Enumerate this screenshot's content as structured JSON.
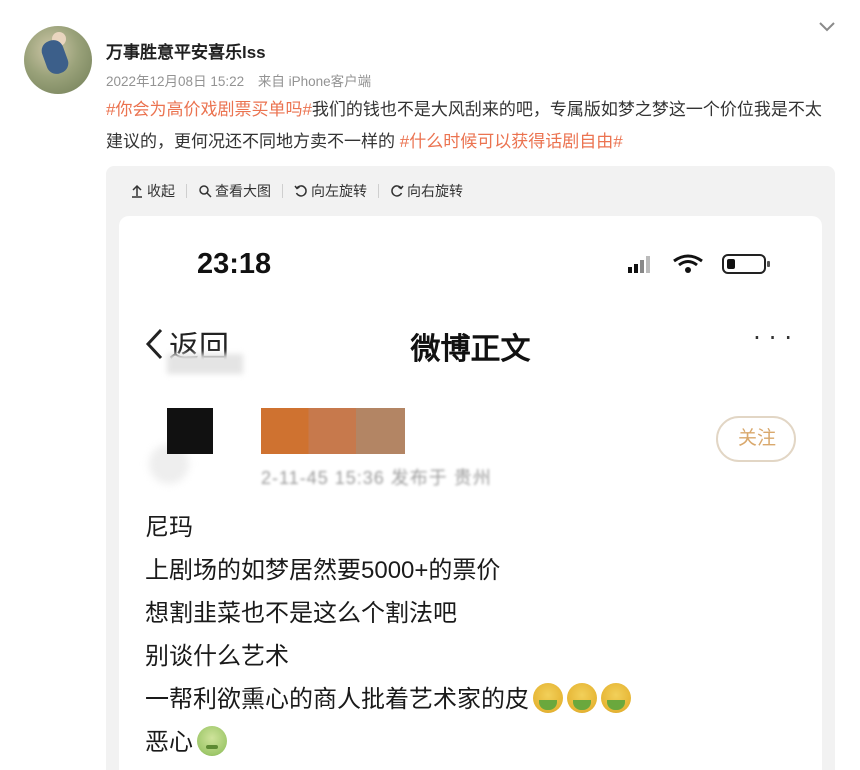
{
  "user": {
    "name": "万事胜意平安喜乐lss",
    "date": "2022年12月08日 15:22",
    "source": "来自 iPhone客户端"
  },
  "post": {
    "tag1": "#你会为高价戏剧票买单吗#",
    "text1": "我们的钱也不是大风刮来的吧，专属版如梦之梦这一个价位我是不太建议的，更何况还不同地方卖不一样的 ",
    "tag2": "#什么时候可以获得话剧自由#"
  },
  "toolbar": {
    "collapse": "收起",
    "view_large": "查看大图",
    "rotate_left": "向左旋转",
    "rotate_right": "向右旋转"
  },
  "screenshot": {
    "time": "23:18",
    "back": "返回",
    "title": "微博正文",
    "more": "···",
    "follow": "关注",
    "subline": "2-11-45 15:36  发布于 贵州",
    "lines": [
      "尼玛",
      "上剧场的如梦居然要5000+的票价",
      "想割韭菜也不是这么个割法吧",
      "别谈什么艺术",
      "一帮利欲熏心的商人批着艺术家的皮",
      "恶心"
    ]
  },
  "colors": {
    "accent": "#eb7350",
    "muted": "#939393",
    "panel_bg": "#f2f2f2"
  }
}
